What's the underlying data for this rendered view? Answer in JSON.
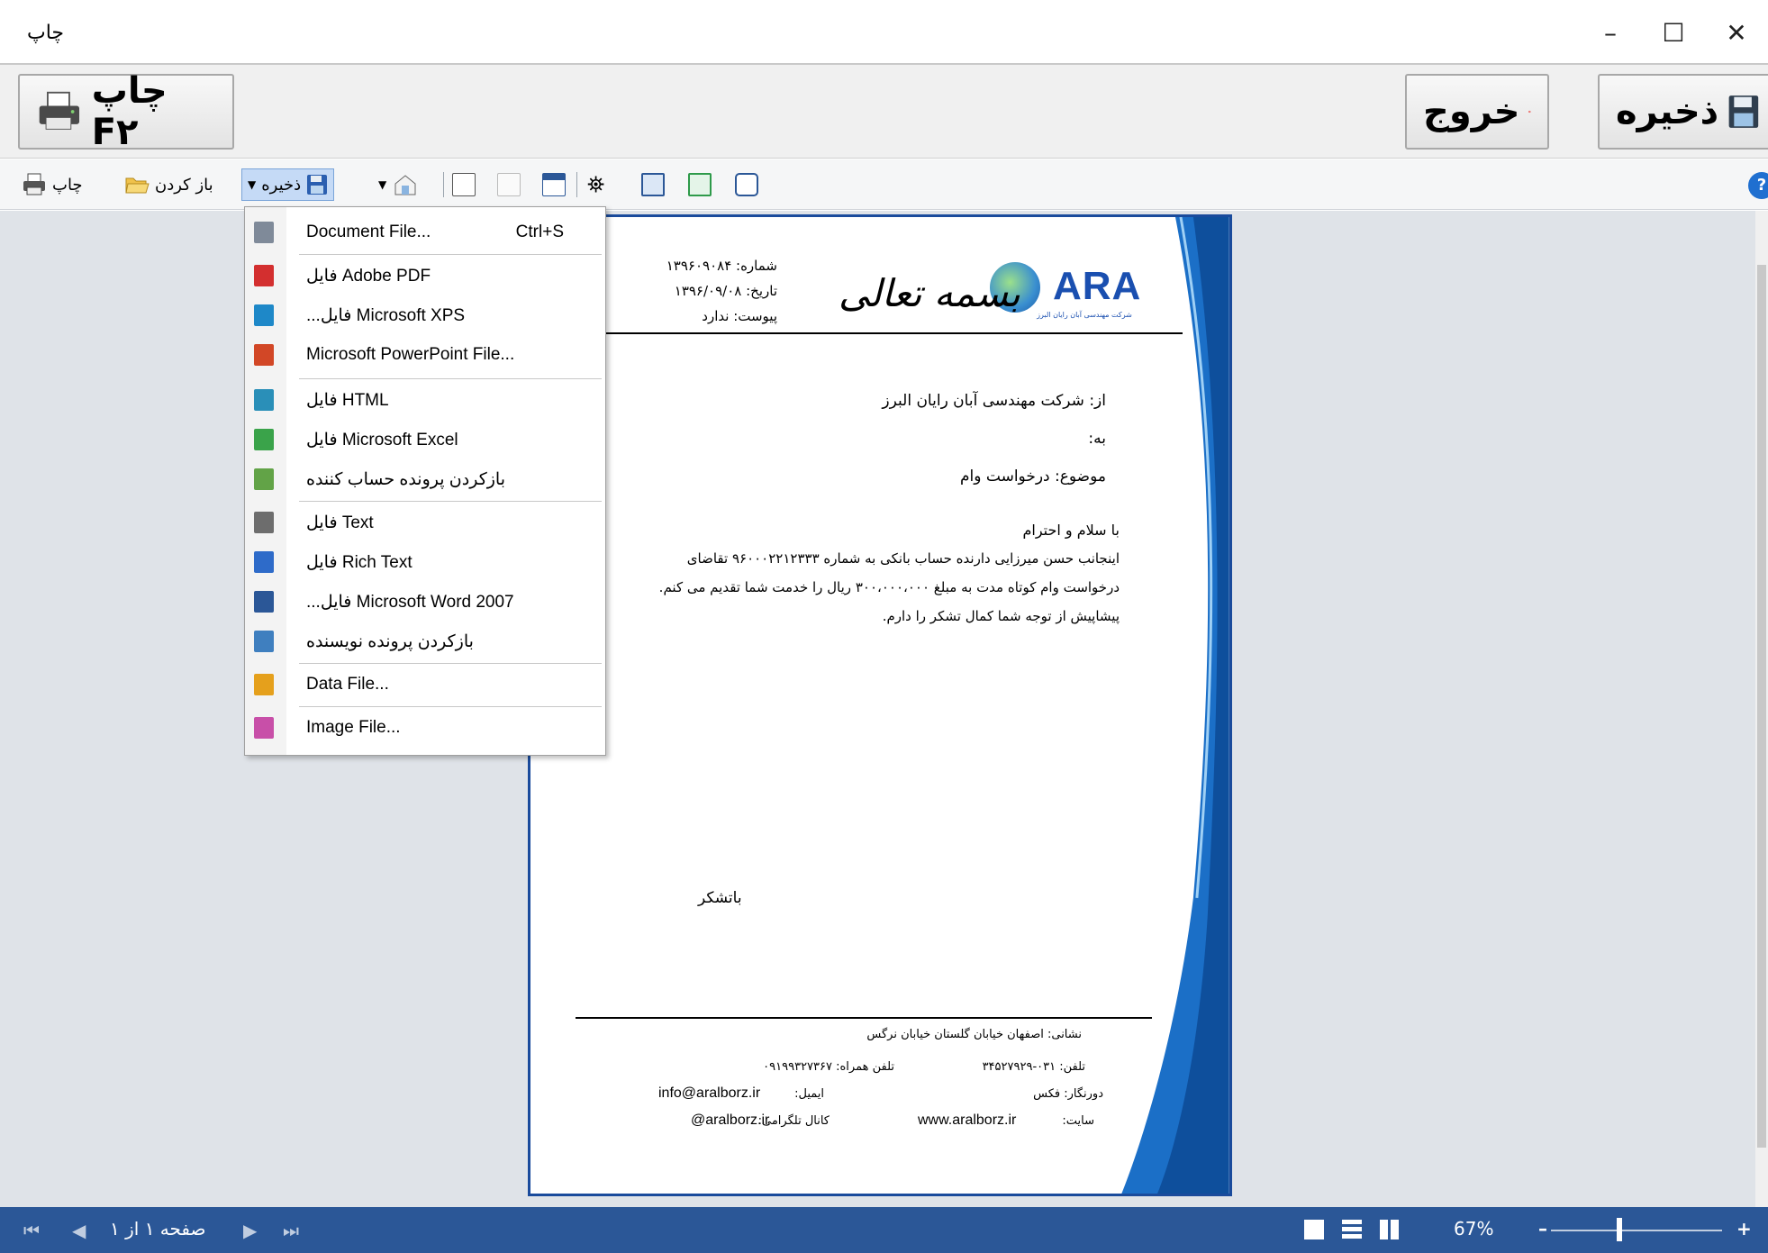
{
  "window": {
    "title": "چاپ",
    "minimize": "–",
    "maximize": "☐",
    "close": "✕"
  },
  "big_buttons": {
    "print_label": "چاپ F۲",
    "exit_label": "خروج",
    "save_label": "ذخیره"
  },
  "toolbar": {
    "print_label": "چاپ",
    "open_label": "باز کردن",
    "save_label": "ذخیره",
    "help": "?"
  },
  "save_menu": {
    "items": [
      {
        "label": "Document File...",
        "shortcut": "Ctrl+S",
        "icon": "doc",
        "color": "#7f8a99"
      },
      {
        "label": "فایل Adobe PDF",
        "icon": "PDF",
        "color": "#d32f2f"
      },
      {
        "label": "...فایل Microsoft XPS",
        "icon": "XPS",
        "color": "#1e88c8"
      },
      {
        "label": "Microsoft PowerPoint File...",
        "icon": "PPT",
        "color": "#d24726"
      },
      {
        "label": "فایل HTML",
        "icon": "HTM",
        "color": "#2a8fb8"
      },
      {
        "label": "فایل Microsoft Excel",
        "icon": "XLS",
        "color": "#3aa34a"
      },
      {
        "label": "بازکردن پرونده حساب کننده",
        "icon": "ODC",
        "color": "#62a347"
      },
      {
        "label": "فایل Text",
        "icon": "TXT",
        "color": "#6d6d6d"
      },
      {
        "label": "فایل Rich Text",
        "icon": "RTF",
        "color": "#2e6bc9"
      },
      {
        "label": "...فایل Microsoft Word 2007",
        "icon": "DOC",
        "color": "#2b5797"
      },
      {
        "label": "بازکردن پرونده نویسنده",
        "icon": "ODW",
        "color": "#3f7fbf"
      },
      {
        "label": "Data File...",
        "icon": "DBT",
        "color": "#e5a01c"
      },
      {
        "label": "Image File...",
        "icon": "IMG",
        "color": "#c84fa8"
      }
    ]
  },
  "document": {
    "logo_text": "ARA",
    "logo_subtitle": "شرکت مهندسی آبان رایان البرز",
    "basmala": "بسمه تعالی",
    "number": "شماره: ۱۳۹۶۰۹۰۸۴",
    "date": "تاریخ: ۱۳۹۶/۰۹/۰۸",
    "attachment": "پیوست: ندارد",
    "from": "از: شرکت مهندسی آبان رایان البرز",
    "to": "به:",
    "subject": "موضوع: درخواست وام",
    "greeting": "با سلام و احترام",
    "body_1": "اینجانب حسن میرزایی دارنده حساب بانکی به شماره ۹۶۰۰۰۲۲۱۲۳۳۳ تقاضای",
    "body_2": "درخواست وام کوتاه مدت به مبلغ ۳۰۰،۰۰۰،۰۰۰ ریال را خدمت شما تقدیم می کنم.",
    "body_3": "پیشاپیش از توجه شما کمال تشکر را دارم.",
    "thanks": "باتشکر",
    "address": "نشانی: اصفهان خیابان گلستان خیابان نرگس",
    "phone": "تلفن: ۰۳۱-۳۴۵۲۷۹۲۹",
    "mobile": "تلفن همراه: ۰۹۱۹۹۳۲۷۳۶۷",
    "fax": "دورنگار: فکس",
    "email_label": "ایمیل:",
    "email": "info@aralborz.ir",
    "site_label": "سایت:",
    "site": "www.aralborz.ir",
    "channel_label": "کانال تلگرامی:",
    "channel": "@aralborz.ir"
  },
  "status": {
    "page_info": "صفحه ۱ از ۱",
    "zoom": "67%",
    "zoom_minus": "–",
    "zoom_plus": "+"
  }
}
